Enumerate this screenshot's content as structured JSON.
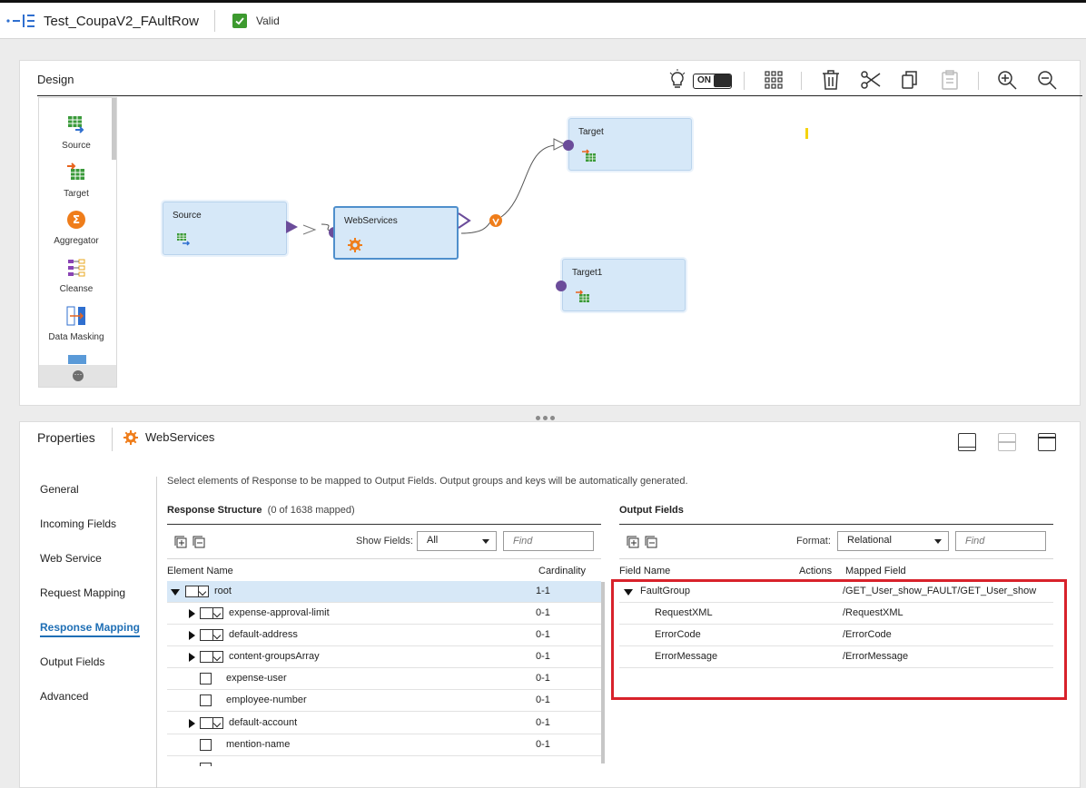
{
  "header": {
    "title": "Test_CoupaV2_FAultRow",
    "status": "Valid"
  },
  "design": {
    "title": "Design",
    "toggle_label": "ON",
    "palette": [
      "Source",
      "Target",
      "Aggregator",
      "Cleanse",
      "Data Masking"
    ],
    "nodes": {
      "source": "Source",
      "webservices": "WebServices",
      "target": "Target",
      "target1": "Target1"
    }
  },
  "properties": {
    "title": "Properties",
    "transform_name": "WebServices",
    "nav": [
      "General",
      "Incoming Fields",
      "Web Service",
      "Request Mapping",
      "Response Mapping",
      "Output Fields",
      "Advanced"
    ],
    "active_nav": "Response Mapping",
    "hint": "Select elements of Response to be mapped to Output Fields. Output groups and keys will be automatically generated.",
    "response": {
      "title": "Response Structure",
      "mapped": "(0 of 1638 mapped)",
      "show_fields_label": "Show Fields:",
      "show_fields_value": "All",
      "find_placeholder": "Find",
      "col_element": "Element Name",
      "col_cardinality": "Cardinality",
      "rows": [
        {
          "name": "root",
          "card": "1-1"
        },
        {
          "name": "expense-approval-limit",
          "card": "0-1"
        },
        {
          "name": "default-address",
          "card": "0-1"
        },
        {
          "name": "content-groupsArray",
          "card": "0-1"
        },
        {
          "name": "expense-user",
          "card": "0-1"
        },
        {
          "name": "employee-number",
          "card": "0-1"
        },
        {
          "name": "default-account",
          "card": "0-1"
        },
        {
          "name": "mention-name",
          "card": "0-1"
        }
      ]
    },
    "output": {
      "title": "Output Fields",
      "format_label": "Format:",
      "format_value": "Relational",
      "find_placeholder": "Find",
      "col_field": "Field Name",
      "col_actions": "Actions",
      "col_mapped": "Mapped Field",
      "rows": [
        {
          "name": "FaultGroup",
          "mapped": "/GET_User_show_FAULT/GET_User_show"
        },
        {
          "name": "RequestXML",
          "mapped": "/RequestXML"
        },
        {
          "name": "ErrorCode",
          "mapped": "/ErrorCode"
        },
        {
          "name": "ErrorMessage",
          "mapped": "/ErrorMessage"
        }
      ]
    }
  },
  "colors": {
    "accent": "#1f6fb5",
    "valid": "#3d9a2f",
    "highlight": "#d8222b",
    "node": "#d6e8f8",
    "port": "#6b4c9a"
  }
}
